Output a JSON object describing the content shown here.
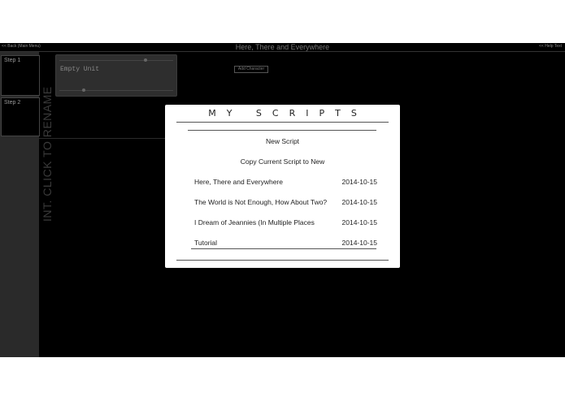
{
  "app": {
    "top_left_link": "<< Back (Main Menu)",
    "title": "Here, There and Everywhere",
    "top_right_link": "<< Help Text",
    "vertical_title": "INT. CLICK TO RENAME",
    "steps": [
      {
        "label": "Step 1"
      },
      {
        "label": "Step 2"
      }
    ],
    "unit_card": {
      "text": "Empty Unit"
    },
    "mini_button": "Add Character"
  },
  "modal": {
    "title": "MY SCRIPTS",
    "new_script": "New Script",
    "copy_script": "Copy Current Script to New",
    "scripts": [
      {
        "name": "Here, There and Everywhere",
        "date": "2014-10-15"
      },
      {
        "name": "The World is Not Enough, How About Two?",
        "date": "2014-10-15"
      },
      {
        "name": "I Dream of Jeannies (In Multiple Places",
        "date": "2014-10-15"
      },
      {
        "name": "Tutorial",
        "date": "2014-10-15"
      }
    ]
  }
}
